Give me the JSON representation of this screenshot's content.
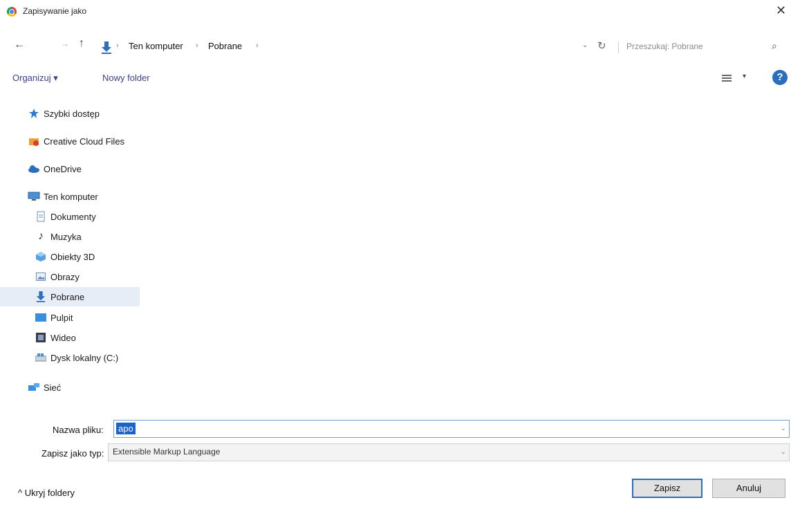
{
  "window": {
    "title": "Zapisywanie jako",
    "close_glyph": "✕"
  },
  "nav": {
    "back_glyph": "←",
    "forward_glyph": "→",
    "up_glyph": "↑",
    "sep_glyph": "›",
    "breadcrumbs": [
      "Ten komputer",
      "Pobrane"
    ],
    "dropdown_glyph": "⌄",
    "refresh_glyph": "↻",
    "search_placeholder": "Przeszukaj: Pobrane",
    "search_glyph": "⌕"
  },
  "toolbar": {
    "organize_label": "Organizuj ▾",
    "new_folder_label": "Nowy folder",
    "view_chevron": "▾",
    "help_glyph": "?"
  },
  "sidebar": {
    "items": [
      {
        "label": "Szybki dostęp",
        "icon": "star-icon"
      },
      {
        "label": "Creative Cloud Files",
        "icon": "creative-cloud-icon"
      },
      {
        "label": "OneDrive",
        "icon": "cloud-icon"
      },
      {
        "label": "Ten komputer",
        "icon": "computer-icon"
      },
      {
        "label": "Dokumenty",
        "icon": "document-icon"
      },
      {
        "label": "Muzyka",
        "icon": "music-note-icon",
        "glyph": "♪"
      },
      {
        "label": "Obiekty 3D",
        "icon": "cube-icon"
      },
      {
        "label": "Obrazy",
        "icon": "picture-icon"
      },
      {
        "label": "Pobrane",
        "icon": "download-arrow-icon",
        "selected": true
      },
      {
        "label": "Pulpit",
        "icon": "desktop-icon"
      },
      {
        "label": "Wideo",
        "icon": "film-icon"
      },
      {
        "label": "Dysk lokalny (C:)",
        "icon": "drive-icon"
      },
      {
        "label": "Sieć",
        "icon": "network-icon"
      }
    ]
  },
  "form": {
    "filename_label": "Nazwa pliku:",
    "filename_value": "apo",
    "filetype_label": "Zapisz jako typ:",
    "filetype_value": "Extensible Markup Language",
    "dropdown_glyph": "⌄"
  },
  "footer": {
    "hide_folders_label": "^ Ukryj foldery",
    "save_label": "Zapisz",
    "cancel_label": "Anuluj"
  },
  "colors": {
    "accent": "#2a6ebd",
    "selection": "#1a63c9",
    "selected_row": "#e6edf7",
    "link": "#3a3f8a"
  }
}
